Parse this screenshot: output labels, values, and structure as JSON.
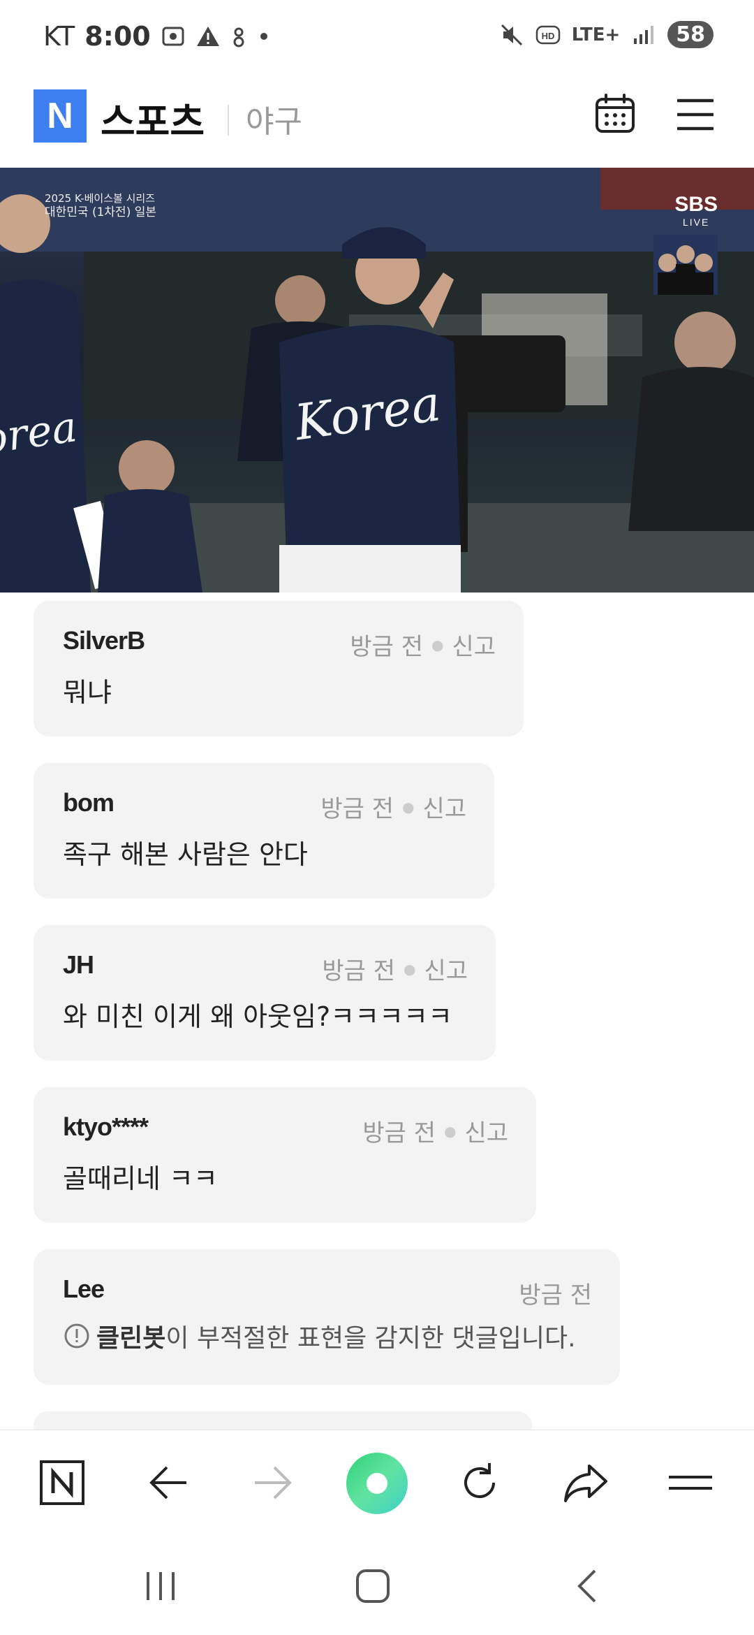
{
  "status_bar": {
    "carrier": "KT",
    "time": "8:00",
    "network": "LTE+",
    "battery": "58"
  },
  "header": {
    "logo_letter": "N",
    "section": "스포츠",
    "subsection": "야구"
  },
  "video": {
    "caption_line1": "2025 K-베이스볼 시리즈",
    "caption_line2": "대한민국 (1차전) 일본",
    "broadcaster": "SBS",
    "live_label": "LIVE"
  },
  "comments": [
    {
      "author": "SilverB",
      "time": "방금 전",
      "report": "신고",
      "text": "뭐냐"
    },
    {
      "author": "bom",
      "time": "방금 전",
      "report": "신고",
      "text": "족구 해본 사람은 안다"
    },
    {
      "author": "JH",
      "time": "방금 전",
      "report": "신고",
      "text": "와 미친 이게 왜 아웃임?ㅋㅋㅋㅋㅋ"
    },
    {
      "author": "ktyo****",
      "time": "방금 전",
      "report": "신고",
      "text": "골때리네 ㅋㅋ"
    },
    {
      "author": "Lee",
      "time": "방금 전",
      "bot_name": "클린봇",
      "bot_text": "이 부적절한 표현을 감지한 댓글입니다."
    }
  ],
  "colors": {
    "naver_blue": "#3d7ff0",
    "comment_bg": "#f3f3f3",
    "home_green": "#2fd27a"
  },
  "toolbar_icons": [
    "naver-home-icon",
    "back-icon",
    "forward-icon",
    "green-dot-icon",
    "refresh-icon",
    "share-icon",
    "menu-icon"
  ],
  "system_nav_icons": [
    "recent-apps-icon",
    "home-icon",
    "system-back-icon"
  ]
}
